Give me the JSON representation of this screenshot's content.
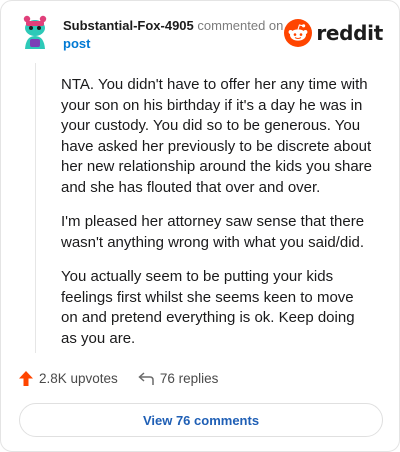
{
  "comment": {
    "author": "Substantial-Fox-4905",
    "action": "commented on",
    "target": "post",
    "paragraphs": [
      "NTA. You didn't have to offer her any time with your son on his birthday if it's a day he was in your custody. You did so to be generous. You have asked her previously to be discrete about her new relationship around the kids you share and she has flouted that over and over.",
      "I'm pleased her attorney saw sense that there wasn't anything wrong with what you said/did.",
      "You actually seem to be putting your kids feelings first whilst she seems keen to move on and pretend everything is ok. Keep doing as you are."
    ]
  },
  "brand": {
    "name": "reddit",
    "accent": "#ff4500"
  },
  "stats": {
    "upvotes": "2.8K upvotes",
    "replies": "76 replies"
  },
  "footer": {
    "view_comments": "View 76 comments"
  },
  "icons": {
    "upvote": "upvote-arrow-icon",
    "reply": "reply-arrow-icon",
    "logo": "reddit-alien-icon",
    "avatar": "snoo-avatar-icon"
  }
}
